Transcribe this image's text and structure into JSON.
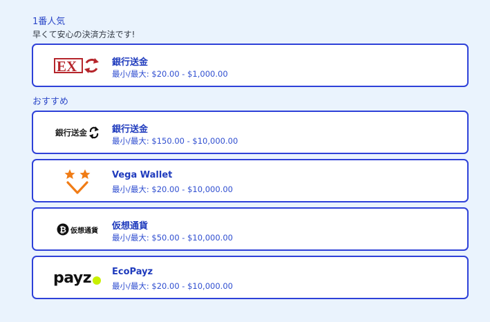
{
  "popular": {
    "heading": "1番人気",
    "subheading": "早くて安心の決済方法です!",
    "methods": [
      {
        "name": "銀行送金",
        "range": "最小/最大: $20.00 - $1,000.00",
        "logo": "ex-transfer-logo"
      }
    ]
  },
  "recommended": {
    "heading": "おすすめ",
    "methods": [
      {
        "name": "銀行送金",
        "range": "最小/最大: $150.00 - $10,000.00",
        "logo": "bank-transfer-logo",
        "logo_text": "銀行送金"
      },
      {
        "name": "Vega Wallet",
        "range": "最小/最大: $20.00 - $10,000.00",
        "logo": "vega-wallet-logo"
      },
      {
        "name": "仮想通貨",
        "range": "最小/最大: $50.00 - $10,000.00",
        "logo": "crypto-logo",
        "logo_text": "仮想通貨"
      },
      {
        "name": "EcoPayz",
        "range": "最小/最大: $20.00 - $10,000.00",
        "logo": "payz-logo",
        "logo_text": "payz"
      }
    ]
  },
  "colors": {
    "background": "#eaf3fd",
    "card_border": "#2d40d8",
    "accent_text": "#1f3bbd",
    "ex_red": "#b5252b",
    "vega_orange": "#f07c16",
    "payz_dot": "#c8f000"
  }
}
